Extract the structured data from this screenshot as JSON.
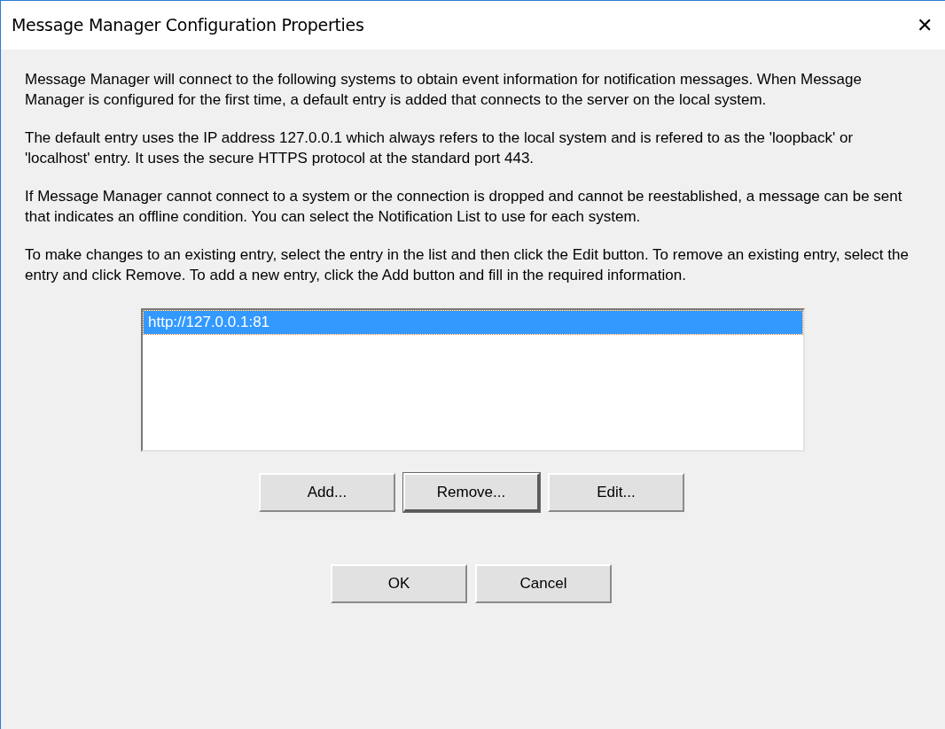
{
  "window": {
    "title": "Message Manager Configuration Properties",
    "close": "✕"
  },
  "paragraphs": [
    "Message Manager will connect to the following systems to obtain event information for notification messages. When Message Manager is configured for the first time, a default entry is added that connects to the server on the local system.",
    "The default entry uses the IP address 127.0.0.1 which always refers to the local system and is refered to as the 'loopback' or 'localhost' entry. It uses the secure HTTPS protocol at the standard port 443.",
    "If Message Manager cannot connect to a system or the connection is dropped and cannot be reestablished, a message can be sent that indicates an offline condition. You can select the Notification List to use for each system.",
    "To make changes to an existing entry, select the entry in the list and then click the Edit button. To remove an existing entry, select the entry and click Remove. To add a new entry, click the Add button and fill in the required information."
  ],
  "systems_list": [
    {
      "label": "http://127.0.0.1:81",
      "selected": true
    }
  ],
  "list_buttons": [
    {
      "label": "Add...",
      "default": false
    },
    {
      "label": "Remove...",
      "default": true
    },
    {
      "label": "Edit...",
      "default": false
    }
  ],
  "dialog_buttons": [
    {
      "label": "OK",
      "default": false
    },
    {
      "label": "Cancel",
      "default": false
    }
  ]
}
